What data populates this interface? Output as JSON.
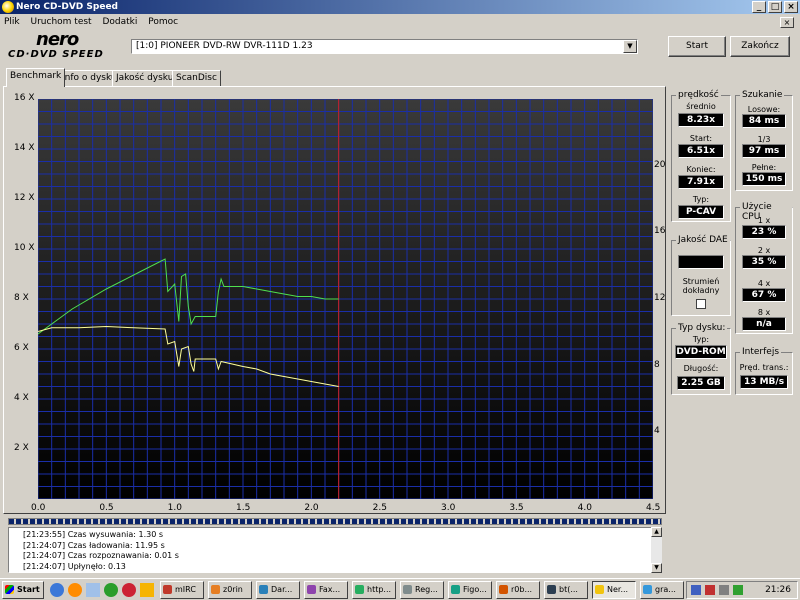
{
  "window": {
    "title": "Nero CD-DVD Speed"
  },
  "menu": [
    "Plik",
    "Uruchom test",
    "Dodatki",
    "Pomoc"
  ],
  "logo": {
    "line1": "nero",
    "line2": "CD·DVD SPEED"
  },
  "drive": {
    "selected": "[1:0]  PIONEER DVD-RW  DVR-111D 1.23"
  },
  "buttons": {
    "start": "Start",
    "exit": "Zakończ"
  },
  "tabs": [
    "Benchmark",
    "Info o dysku",
    "Jakość dysku",
    "ScanDisc"
  ],
  "chart_data": {
    "type": "line",
    "x_ticks": [
      "0.0",
      "0.5",
      "1.0",
      "1.5",
      "2.0",
      "2.5",
      "3.0",
      "3.5",
      "4.0",
      "4.5"
    ],
    "xlim": [
      0,
      4.5
    ],
    "y_left_ticks": [
      "2 X",
      "4 X",
      "6 X",
      "8 X",
      "10 X",
      "12 X",
      "14 X",
      "16 X"
    ],
    "ylim_left": [
      0,
      16
    ],
    "y_right_ticks": [
      "4",
      "8",
      "12",
      "16",
      "20"
    ],
    "ylim_right": [
      0,
      24
    ],
    "marker_x": 2.2,
    "background": "#000000",
    "grid_color": "#1a2ea8",
    "series": [
      {
        "color": "#4fe04f",
        "points": [
          [
            0,
            6.6
          ],
          [
            0.25,
            7.6
          ],
          [
            0.5,
            8.4
          ],
          [
            0.75,
            9.1
          ],
          [
            0.93,
            9.6
          ],
          [
            0.95,
            8.3
          ],
          [
            1.0,
            8.6
          ],
          [
            1.03,
            7.1
          ],
          [
            1.05,
            8.9
          ],
          [
            1.08,
            9.0
          ],
          [
            1.1,
            7.7
          ],
          [
            1.12,
            7.0
          ],
          [
            1.15,
            7.3
          ],
          [
            1.3,
            7.3
          ],
          [
            1.32,
            8.3
          ],
          [
            1.34,
            8.8
          ],
          [
            1.36,
            8.5
          ],
          [
            1.5,
            8.5
          ],
          [
            1.6,
            8.4
          ],
          [
            1.7,
            8.3
          ],
          [
            1.8,
            8.2
          ],
          [
            1.9,
            8.1
          ],
          [
            2.0,
            8.1
          ],
          [
            2.1,
            8.0
          ],
          [
            2.2,
            8.0
          ]
        ]
      },
      {
        "color": "#ffff99",
        "points": [
          [
            0,
            6.7
          ],
          [
            0.1,
            6.85
          ],
          [
            0.3,
            6.85
          ],
          [
            0.5,
            6.9
          ],
          [
            0.7,
            6.85
          ],
          [
            0.93,
            6.8
          ],
          [
            0.95,
            6.2
          ],
          [
            1.0,
            6.3
          ],
          [
            1.03,
            5.3
          ],
          [
            1.05,
            6.0
          ],
          [
            1.1,
            6.1
          ],
          [
            1.12,
            5.4
          ],
          [
            1.14,
            5.1
          ],
          [
            1.15,
            5.6
          ],
          [
            1.3,
            5.6
          ],
          [
            1.32,
            5.2
          ],
          [
            1.34,
            5.5
          ],
          [
            1.5,
            5.3
          ],
          [
            1.6,
            5.2
          ],
          [
            1.7,
            5.0
          ],
          [
            1.8,
            4.9
          ],
          [
            1.9,
            4.8
          ],
          [
            2.0,
            4.7
          ],
          [
            2.1,
            4.6
          ],
          [
            2.2,
            4.5
          ]
        ]
      }
    ]
  },
  "speed": {
    "title": "prędkość",
    "avg_label": "średnio",
    "avg": "8.23x",
    "start_label": "Start:",
    "start": "6.51x",
    "end_label": "Koniec:",
    "end": "7.91x",
    "type_label": "Typ:",
    "type": "P-CAV"
  },
  "seek": {
    "title": "Szukanie",
    "random_label": "Losowe:",
    "random": "84 ms",
    "third_label": "1/3",
    "third": "97 ms",
    "full_label": "Pełne:",
    "full": "150 ms"
  },
  "cpu": {
    "title": "Użycie CPU",
    "x1_label": "1 x",
    "x1": "23 %",
    "x2_label": "2 x",
    "x2": "35 %",
    "x4_label": "4 x",
    "x4": "67 %",
    "x8_label": "8 x",
    "x8": "n/a"
  },
  "dae": {
    "title": "Jakość DAE",
    "value": "",
    "accurate_label": "Strumień dokładny"
  },
  "disc": {
    "title": "Typ dysku:",
    "type_label": "Typ:",
    "type": "DVD-ROM",
    "length_label": "Długość:",
    "length": "2.25 GB"
  },
  "iface": {
    "title": "Interfejs",
    "rate_label": "Pręd. trans.:",
    "rate": "13 MB/s"
  },
  "log": [
    "[21:23:55]   Czas wysuwania: 1.30 s",
    "[21:24:07]   Czas ładowania: 11.95 s",
    "[21:24:07]   Czas rozpoznawania: 0.01 s",
    "[21:24:07]   Upłynęło:  0.13"
  ],
  "taskbar": {
    "start": "Start",
    "items": [
      "mIRC",
      "z0rin",
      "Dar...",
      "Fax...",
      "http...",
      "Reg...",
      "Figo...",
      "r0b...",
      "bt(...",
      "Ner...",
      "gra..."
    ],
    "clock": "21:26"
  }
}
